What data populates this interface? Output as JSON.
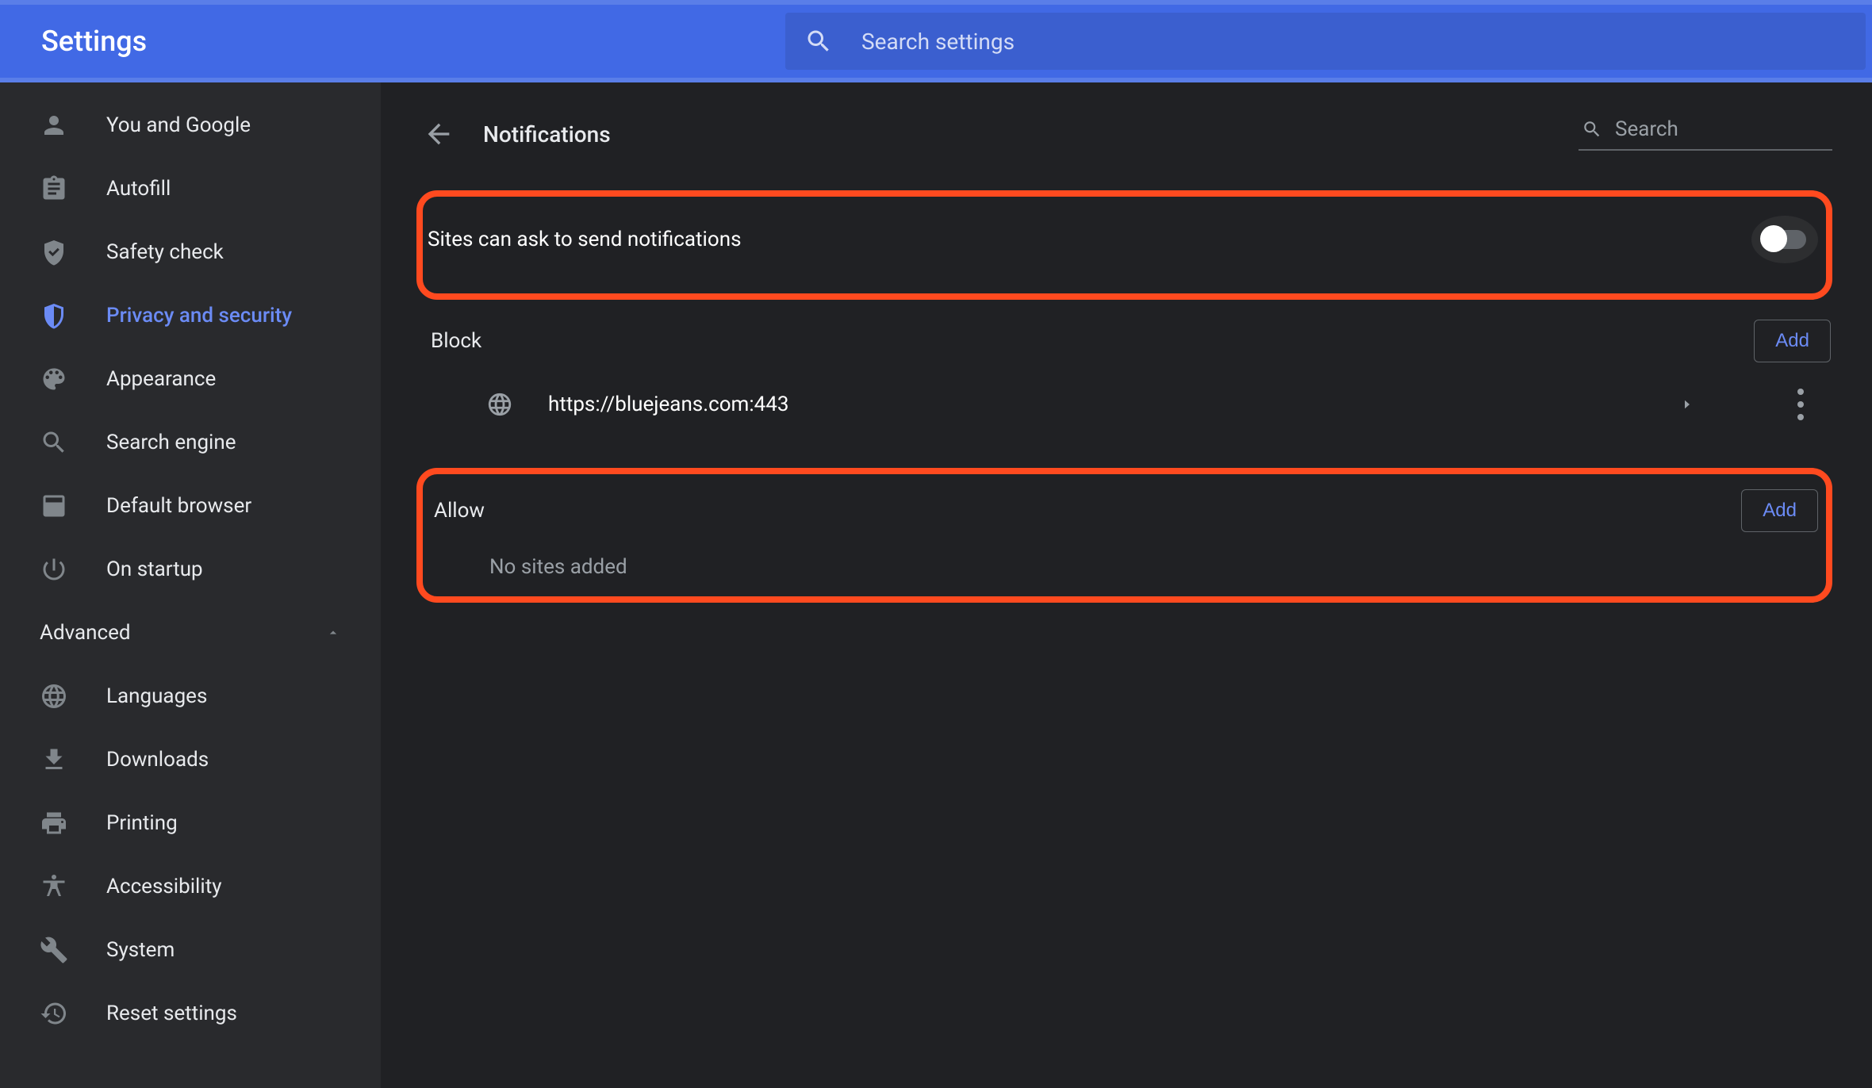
{
  "header": {
    "title": "Settings",
    "search_placeholder": "Search settings"
  },
  "sidebar": {
    "items": [
      {
        "label": "You and Google"
      },
      {
        "label": "Autofill"
      },
      {
        "label": "Safety check"
      },
      {
        "label": "Privacy and security",
        "active": true
      },
      {
        "label": "Appearance"
      },
      {
        "label": "Search engine"
      },
      {
        "label": "Default browser"
      },
      {
        "label": "On startup"
      }
    ],
    "advanced_label": "Advanced",
    "advanced_items": [
      {
        "label": "Languages"
      },
      {
        "label": "Downloads"
      },
      {
        "label": "Printing"
      },
      {
        "label": "Accessibility"
      },
      {
        "label": "System"
      },
      {
        "label": "Reset settings"
      }
    ]
  },
  "page": {
    "title": "Notifications",
    "search_label": "Search",
    "toggle_label": "Sites can ask to send notifications",
    "toggle_on": false,
    "block": {
      "title": "Block",
      "add_label": "Add",
      "sites": [
        {
          "url": "https://bluejeans.com:443"
        }
      ]
    },
    "allow": {
      "title": "Allow",
      "add_label": "Add",
      "empty_label": "No sites added"
    }
  },
  "colors": {
    "accent": "#6b8bf5",
    "highlight": "#ff4a1f"
  }
}
